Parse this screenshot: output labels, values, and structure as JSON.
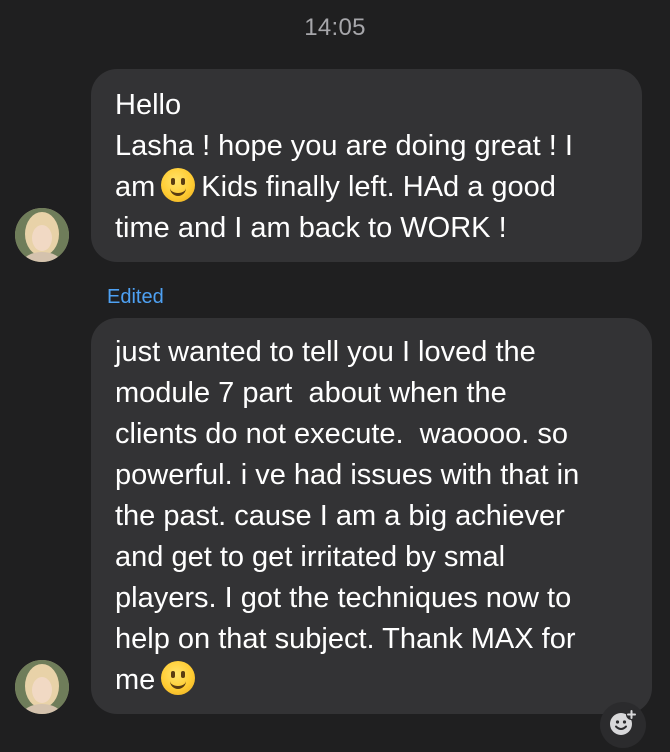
{
  "timestamp": "14:05",
  "messages": [
    {
      "lines": [
        [
          "Hello"
        ],
        [
          "Lasha ! hope you are doing great ! I"
        ],
        [
          "am",
          "Kids finally left. HAd a good"
        ],
        [
          "time and I am back to WORK !"
        ]
      ]
    },
    {
      "edited_label": "Edited",
      "lines": [
        [
          "just wanted to tell you I loved the"
        ],
        [
          "module 7 part  about when the"
        ],
        [
          "clients do not execute.  waoooo. so"
        ],
        [
          "powerful. i ve had issues with that in"
        ],
        [
          "the past. cause I am a big achiever"
        ],
        [
          "and get to get irritated by smal"
        ],
        [
          "players. I got the techniques now to"
        ],
        [
          "help on that subject. Thank MAX for"
        ],
        [
          "me"
        ]
      ]
    }
  ],
  "icons": {
    "emoji": "slightly-smiling-face-emoji",
    "reaction": "add-reaction-icon",
    "avatar": "user-avatar"
  }
}
